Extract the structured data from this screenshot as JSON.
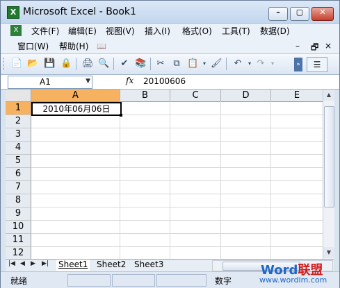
{
  "window": {
    "title": "Microsoft Excel - Book1",
    "app_icon": "X",
    "minimize": "–",
    "maximize": "▢",
    "close": "✕"
  },
  "menu": {
    "row1": [
      "文件(F)",
      "编辑(E)",
      "视图(V)",
      "插入(I)",
      "格式(O)",
      "工具(T)",
      "数据(D)"
    ],
    "row2": [
      "窗口(W)",
      "帮助(H)"
    ],
    "mdi": {
      "minimize": "–",
      "restore": "🗗",
      "close": "×"
    }
  },
  "toolbar": {
    "icons": [
      "new-icon",
      "open-icon",
      "save-icon",
      "permission-icon",
      "print-icon",
      "print-preview-icon",
      "spelling-icon",
      "research-icon",
      "cut-icon",
      "copy-icon",
      "paste-icon",
      "format-painter-icon",
      "undo-icon",
      "redo-icon"
    ],
    "glyphs": [
      "📄",
      "📂",
      "💾",
      "🔒",
      "🖨",
      "🔍",
      "✔",
      "📚",
      "✂",
      "⧉",
      "📋",
      "🖌",
      "↶",
      "↷"
    ]
  },
  "formula_bar": {
    "name_box": "A1",
    "fx": "fx",
    "value": "20100606"
  },
  "grid": {
    "columns": [
      "A",
      "B",
      "C",
      "D",
      "E"
    ],
    "rows": [
      "1",
      "2",
      "3",
      "4",
      "5",
      "6",
      "7",
      "8",
      "9",
      "10",
      "11",
      "12"
    ],
    "selected_col": "A",
    "selected_row": "1",
    "cells": {
      "A1": "2010年06月06日"
    }
  },
  "sheets": {
    "tabs": [
      "Sheet1",
      "Sheet2",
      "Sheet3"
    ],
    "active": "Sheet1",
    "nav": [
      "|◀",
      "◀",
      "▶",
      "▶|"
    ]
  },
  "status": {
    "ready": "就绪",
    "num": "数字"
  },
  "watermark": {
    "word": "Word",
    "cn": "联盟",
    "url": "www.wordlm.com"
  }
}
